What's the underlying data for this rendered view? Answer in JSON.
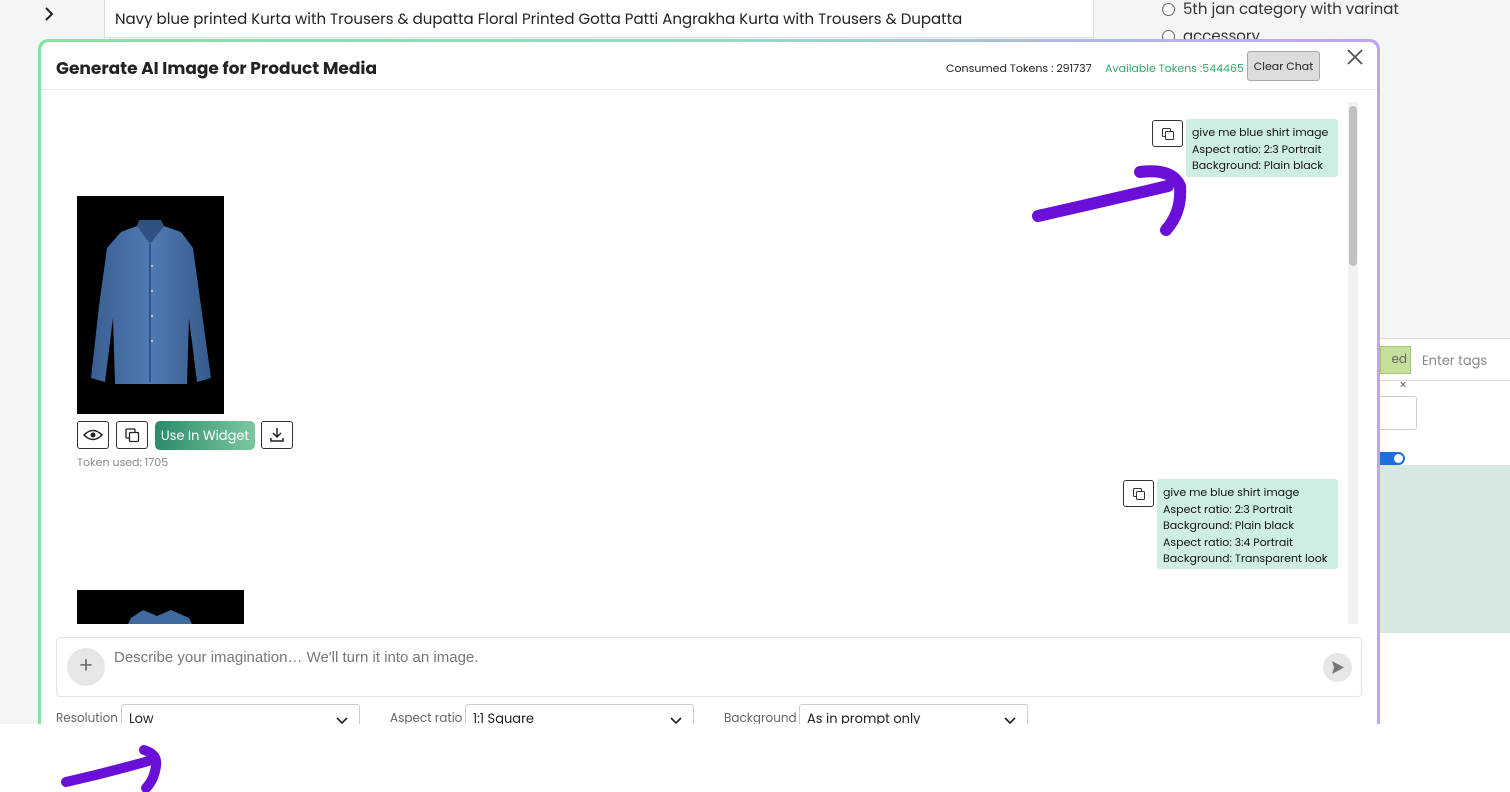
{
  "background": {
    "page_title": "Navy blue printed Kurta with Trousers & dupatta Floral Printed Gotta Patti Angrakha Kurta with Trousers & Dupatta",
    "categories": [
      "5th jan category with varinat",
      "accessory"
    ],
    "tag_chip": "ed",
    "tags_placeholder": "Enter tags"
  },
  "modal": {
    "title": "Generate AI Image for Product Media",
    "consumed_tokens": "Consumed Tokens : 291737",
    "available_tokens": "Available Tokens :544465",
    "clear_chat": "Clear Chat"
  },
  "chat": {
    "messages": [
      {
        "lines": [
          "give me blue shirt image",
          "Aspect ratio: 2:3 Portrait",
          "Background: Plain black"
        ]
      },
      {
        "lines": [
          "give me blue shirt image",
          "Aspect ratio: 2:3 Portrait",
          "Background: Plain black",
          "Aspect ratio: 3:4 Portrait",
          "Background: Transparent look"
        ]
      }
    ],
    "result": {
      "use_in_widget": "Use In Widget",
      "token_used": "Token used: 1705"
    }
  },
  "prompt": {
    "placeholder": "Describe your imagination… We'll turn it into an image."
  },
  "options": {
    "resolution": {
      "label": "Resolution",
      "value": "Low"
    },
    "aspect_ratio": {
      "label": "Aspect ratio",
      "value": "1:1 Square"
    },
    "background": {
      "label": "Background",
      "value": "As in prompt only"
    }
  },
  "colors": {
    "accent": "#2eaa6a",
    "bubble": "#cfeee3",
    "annotation": "#6a0fd8"
  }
}
